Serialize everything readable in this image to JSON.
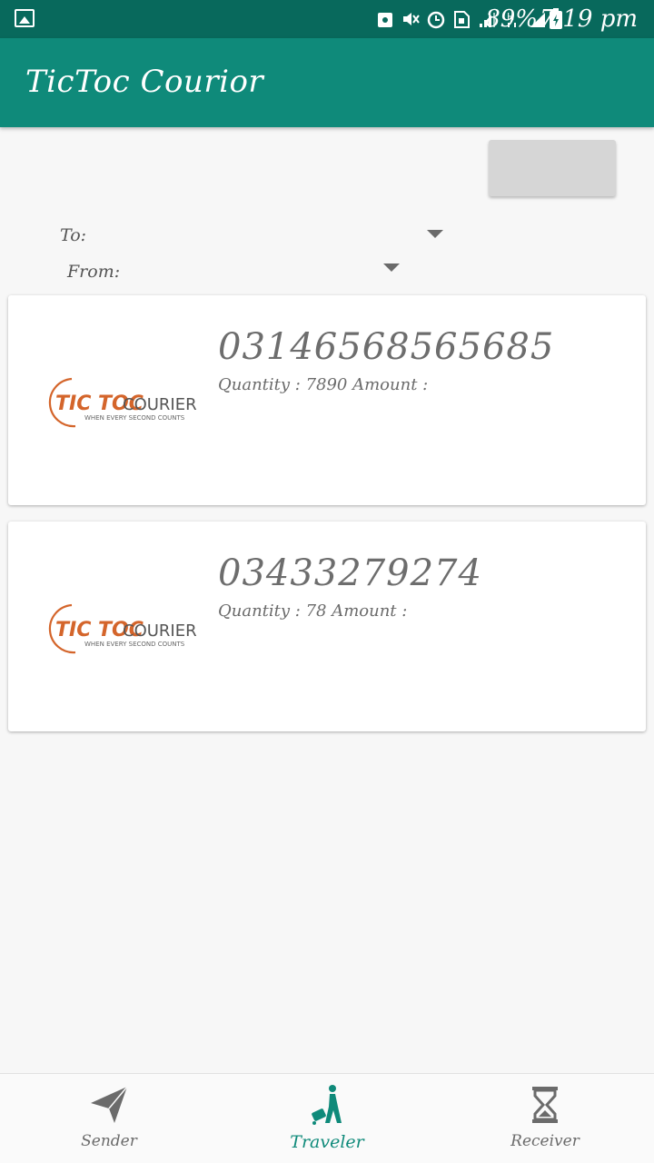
{
  "status_bar": {
    "battery": "89%",
    "time": "7:19 pm",
    "icons": [
      "image-icon",
      "recycle-icon",
      "mute-icon",
      "alarm-icon",
      "sim-icon",
      "signal-icon",
      "h-data-icon",
      "signal-strength-icon",
      "battery-icon"
    ]
  },
  "app_bar": {
    "title": "TicToc Courior"
  },
  "filters": {
    "to_label": "To:",
    "from_label": "From:"
  },
  "cards": [
    {
      "phone": "03146568565685",
      "meta": "Quantity : 7890 Amount :"
    },
    {
      "phone": "03433279274",
      "meta": "Quantity : 78 Amount :"
    }
  ],
  "logo": {
    "brand_text": "TIC TOC COURIER",
    "tagline": "WHEN EVERY SECOND COUNTS",
    "brand_color": "#d4652b"
  },
  "bottom_nav": {
    "items": [
      {
        "label": "Sender",
        "icon": "send-icon"
      },
      {
        "label": "Traveler",
        "icon": "traveler-icon"
      },
      {
        "label": "Receiver",
        "icon": "hourglass-icon"
      }
    ],
    "active_color": "#0f8a7a"
  },
  "colors": {
    "primary": "#0f8a7a",
    "primary_dark": "#08695c"
  }
}
